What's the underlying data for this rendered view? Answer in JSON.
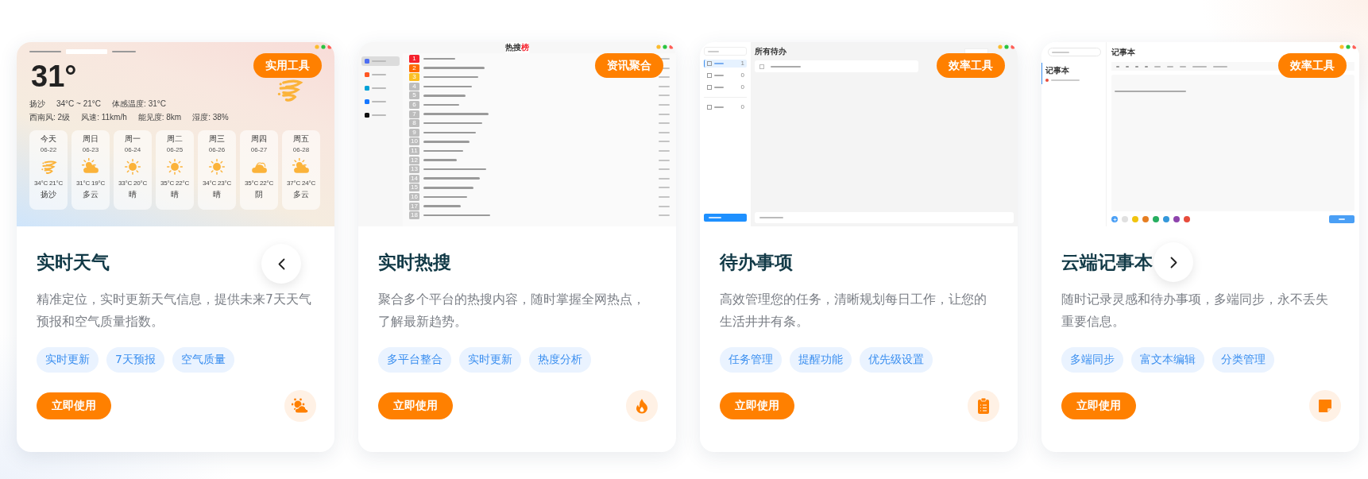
{
  "cards": [
    {
      "kind": "weather",
      "badge": "实用工具",
      "title": "实时天气",
      "description": "精准定位，实时更新天气信息，提供未来7天天气预报和空气质量指数。",
      "tags": [
        "实时更新",
        "7天预报",
        "空气质量"
      ],
      "button": "立即使用",
      "preview": {
        "temperature": "31°",
        "details": [
          [
            "扬沙",
            "34°C ~ 21°C",
            "体感温度: 31°C"
          ],
          [
            "西南风: 2级",
            "风速: 11km/h",
            "能见度: 8km",
            "湿度: 38%"
          ]
        ],
        "days": [
          {
            "day": "今天",
            "date": "06-22",
            "kind": "sand",
            "temps": "34°C  21°C",
            "condition": "扬沙"
          },
          {
            "day": "周日",
            "date": "06-23",
            "kind": "cloudy",
            "temps": "31°C  19°C",
            "condition": "多云"
          },
          {
            "day": "周一",
            "date": "06-24",
            "kind": "sunny",
            "temps": "33°C  20°C",
            "condition": "晴"
          },
          {
            "day": "周二",
            "date": "06-25",
            "kind": "sunny",
            "temps": "35°C  22°C",
            "condition": "晴"
          },
          {
            "day": "周三",
            "date": "06-26",
            "kind": "sunny",
            "temps": "34°C  23°C",
            "condition": "晴"
          },
          {
            "day": "周四",
            "date": "06-27",
            "kind": "overcast",
            "temps": "35°C  22°C",
            "condition": "阴"
          },
          {
            "day": "周五",
            "date": "06-28",
            "kind": "cloudy",
            "temps": "37°C  24°C",
            "condition": "多云"
          }
        ]
      }
    },
    {
      "kind": "hot",
      "badge": "资讯聚合",
      "title": "实时热搜",
      "description": "聚合多个平台的热搜内容，随时掌握全网热点，了解最新趋势。",
      "tags": [
        "多平台整合",
        "实时更新",
        "热度分析"
      ],
      "button": "立即使用",
      "preview": {
        "title": "热搜",
        "title_accent": "榜",
        "sources": [
          {
            "color": "#4e6ef2",
            "selected": true
          },
          {
            "color": "#ff5722",
            "selected": false
          },
          {
            "color": "#00a1d6",
            "selected": false
          },
          {
            "color": "#1677ff",
            "selected": false
          },
          {
            "color": "#111111",
            "selected": false
          }
        ],
        "rows": [
          {
            "rank": "1",
            "color": "#f5222d"
          },
          {
            "rank": "2",
            "color": "#ff6a00"
          },
          {
            "rank": "3",
            "color": "#fbbf24"
          },
          {
            "rank": "4",
            "color": "#bdbdbd"
          },
          {
            "rank": "5",
            "color": "#bdbdbd"
          },
          {
            "rank": "6",
            "color": "#bdbdbd"
          },
          {
            "rank": "7",
            "color": "#bdbdbd"
          },
          {
            "rank": "8",
            "color": "#bdbdbd"
          },
          {
            "rank": "9",
            "color": "#bdbdbd"
          },
          {
            "rank": "10",
            "color": "#bdbdbd"
          },
          {
            "rank": "11",
            "color": "#bdbdbd"
          },
          {
            "rank": "12",
            "color": "#bdbdbd"
          },
          {
            "rank": "13",
            "color": "#bdbdbd"
          },
          {
            "rank": "14",
            "color": "#bdbdbd"
          },
          {
            "rank": "15",
            "color": "#bdbdbd"
          },
          {
            "rank": "16",
            "color": "#bdbdbd"
          },
          {
            "rank": "17",
            "color": "#bdbdbd"
          },
          {
            "rank": "18",
            "color": "#bdbdbd"
          }
        ]
      }
    },
    {
      "kind": "todo",
      "badge": "效率工具",
      "title": "待办事项",
      "description": "高效管理您的任务，清晰规划每日工作，让您的生活井井有条。",
      "tags": [
        "任务管理",
        "提醒功能",
        "优先级设置"
      ],
      "button": "立即使用",
      "preview": {
        "title": "所有待办",
        "lists": [
          {
            "count": "1",
            "selected": true
          },
          {
            "count": "0",
            "selected": false
          },
          {
            "count": "0",
            "selected": false
          },
          {
            "count": "0",
            "selected": false
          }
        ]
      }
    },
    {
      "kind": "notes",
      "badge": "效率工具",
      "title": "云端记事本",
      "description": "随时记录灵感和待办事项，多端同步，永不丢失重要信息。",
      "tags": [
        "多端同步",
        "富文本编辑",
        "分类管理"
      ],
      "button": "立即使用",
      "preview": {
        "title": "记事本",
        "note": {
          "title": "记事本",
          "color": "#e74c3c"
        },
        "colors": [
          {
            "color": "#e0e0e0"
          },
          {
            "color": "#f1c40f"
          },
          {
            "color": "#e67e22"
          },
          {
            "color": "#27ae60"
          },
          {
            "color": "#3498db"
          },
          {
            "color": "#8e44ad"
          },
          {
            "color": "#e74c3c"
          }
        ]
      }
    }
  ]
}
